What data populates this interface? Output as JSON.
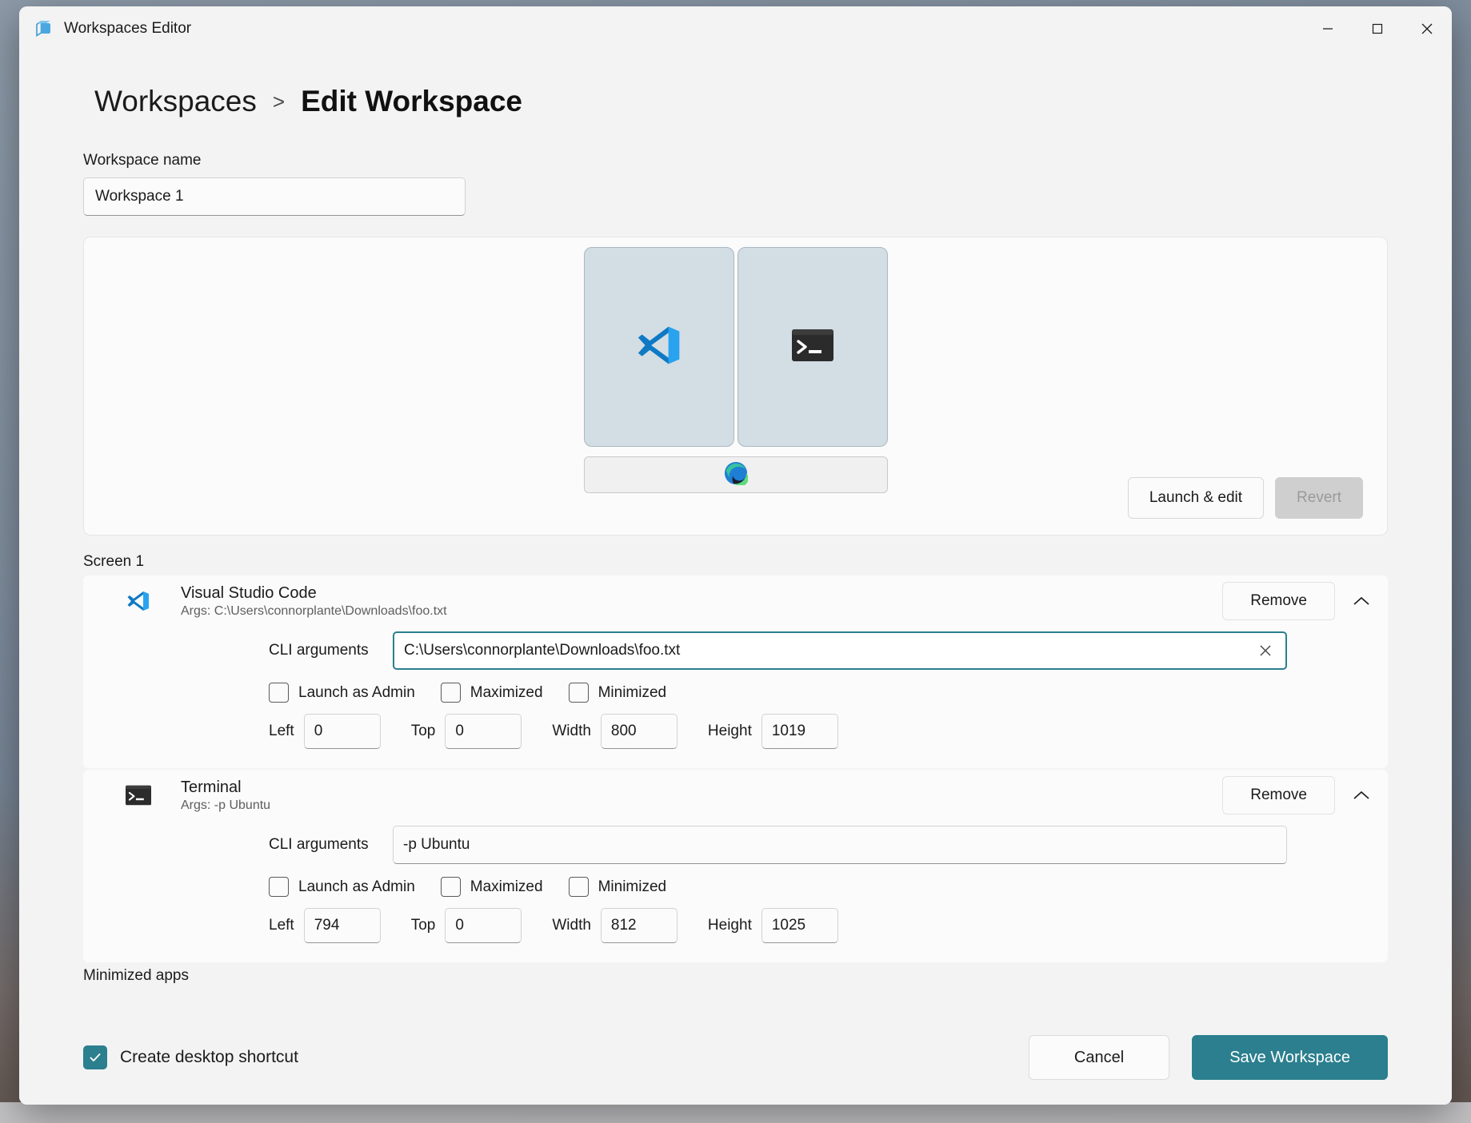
{
  "window": {
    "title": "Workspaces Editor",
    "icon": "workspaces-icon",
    "minimize": "minimize-icon",
    "maximize": "maximize-icon",
    "close": "close-icon"
  },
  "breadcrumb": {
    "parent": "Workspaces",
    "separator": ">",
    "current": "Edit Workspace"
  },
  "workspace_name": {
    "label": "Workspace name",
    "value": "Workspace 1",
    "placeholder": "Workspace name"
  },
  "preview": {
    "windows": [
      {
        "icon": "vscode-icon",
        "app": "Visual Studio Code"
      },
      {
        "icon": "terminal-icon",
        "app": "Terminal"
      }
    ],
    "taskbar": [
      {
        "icon": "edge-icon",
        "app": "Microsoft Edge"
      }
    ],
    "launch_edit_label": "Launch & edit",
    "revert_label": "Revert",
    "revert_disabled": true
  },
  "screen": {
    "label": "Screen 1",
    "minimized_label": "Minimized apps"
  },
  "apps": [
    {
      "name": "Visual Studio Code",
      "icon": "vscode-icon",
      "args_summary": "Args: C:\\Users\\connorplante\\Downloads\\foo.txt",
      "remove_label": "Remove",
      "collapse_icon": "chevron-up-icon",
      "expanded": true,
      "cli": {
        "label": "CLI arguments",
        "value": "C:\\Users\\connorplante\\Downloads\\foo.txt",
        "placeholder": "CLI arguments",
        "focused": true,
        "clear_icon": "clear-icon"
      },
      "checkboxes": [
        {
          "label": "Launch as Admin",
          "checked": false
        },
        {
          "label": "Maximized",
          "checked": false
        },
        {
          "label": "Minimized",
          "checked": false
        }
      ],
      "position": [
        {
          "label": "Left",
          "value": "0"
        },
        {
          "label": "Top",
          "value": "0"
        },
        {
          "label": "Width",
          "value": "800"
        },
        {
          "label": "Height",
          "value": "1019"
        }
      ]
    },
    {
      "name": "Terminal",
      "icon": "terminal-icon",
      "args_summary": "Args: -p Ubuntu",
      "remove_label": "Remove",
      "collapse_icon": "chevron-up-icon",
      "expanded": true,
      "cli": {
        "label": "CLI arguments",
        "value": "-p Ubuntu",
        "placeholder": "CLI arguments",
        "focused": false,
        "clear_icon": "clear-icon"
      },
      "checkboxes": [
        {
          "label": "Launch as Admin",
          "checked": false
        },
        {
          "label": "Maximized",
          "checked": false
        },
        {
          "label": "Minimized",
          "checked": false
        }
      ],
      "position": [
        {
          "label": "Left",
          "value": "794"
        },
        {
          "label": "Top",
          "value": "0"
        },
        {
          "label": "Width",
          "value": "812"
        },
        {
          "label": "Height",
          "value": "1025"
        }
      ]
    }
  ],
  "footer": {
    "shortcut_label": "Create desktop shortcut",
    "shortcut_checked": true,
    "cancel_label": "Cancel",
    "save_label": "Save Workspace"
  },
  "colors": {
    "accent": "#2b7f8e",
    "window_bg": "#f3f3f3",
    "card_bg": "#fbfbfb",
    "preview_window": "#d3dde4"
  }
}
